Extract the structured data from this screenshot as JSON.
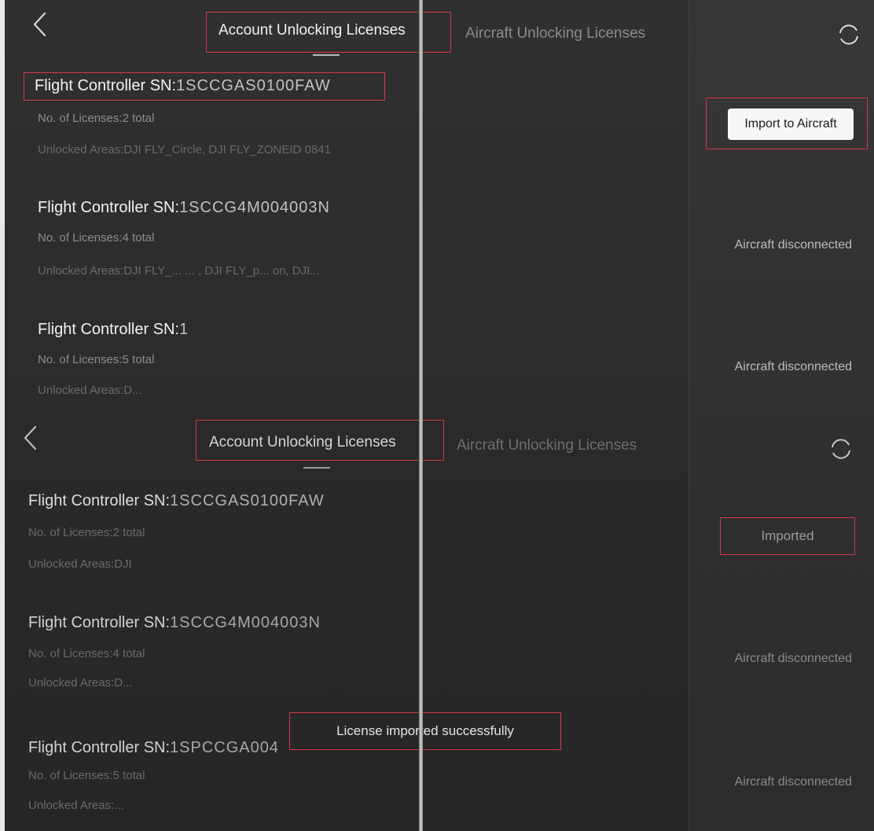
{
  "top_panel": {
    "tabs": [
      {
        "label": "Account Unlocking Licenses",
        "active": true
      },
      {
        "label": "Aircraft Unlocking Licenses",
        "active": false
      }
    ],
    "licenses": [
      {
        "sn_label": "Flight Controller SN:",
        "sn_value": "1SCCGAS0100FAW",
        "licenses_text": "No. of Licenses:2 total",
        "areas_text": "Unlocked Areas:DJI FLY_Circle, DJI FLY_ZONEID 0841",
        "action_label": "Import to Aircraft"
      },
      {
        "sn_label": "Flight Controller SN:",
        "sn_value": "1SCCG4M004003N",
        "licenses_text": "No. of Licenses:4 total",
        "areas_text": "Unlocked Areas:DJI FLY_...  ... , DJI FLY_p... on, DJI...",
        "status": "Aircraft disconnected"
      },
      {
        "sn_label": "Flight Controller SN:",
        "sn_value": "1",
        "licenses_text": "No. of Licenses:5 total",
        "areas_text": "Unlocked Areas:D...",
        "status": "Aircraft disconnected"
      }
    ]
  },
  "bottom_panel": {
    "tabs": [
      {
        "label": "Account Unlocking Licenses",
        "active": true
      },
      {
        "label": "Aircraft Unlocking Licenses",
        "active": false
      }
    ],
    "licenses": [
      {
        "sn_label": "Flight Controller SN:",
        "sn_value": "1SCCGAS0100FAW",
        "licenses_text": "No. of Licenses:2 total",
        "areas_text": "Unlocked Areas:DJI",
        "status": "Imported"
      },
      {
        "sn_label": "Flight Controller SN:",
        "sn_value": "1SCCG4M004003N",
        "licenses_text": "No. of Licenses:4 total",
        "areas_text": "Unlocked Areas:D...",
        "status": "Aircraft disconnected"
      },
      {
        "sn_label": "Flight Controller SN:",
        "sn_value": "1SPCCGA004",
        "licenses_text": "No. of Licenses:5 total",
        "areas_text": "Unlocked Areas:...",
        "status": "Aircraft disconnected"
      }
    ],
    "toast": "License imported successfully"
  },
  "icons": {
    "back": "chevron-left-icon",
    "refresh": "refresh-icon"
  },
  "colors": {
    "background": "#2e2e2e",
    "highlight": "#d23b49",
    "primary_text": "#f2f2f2",
    "secondary_text": "#8d8d8d",
    "button_bg": "#f7f7f7"
  }
}
